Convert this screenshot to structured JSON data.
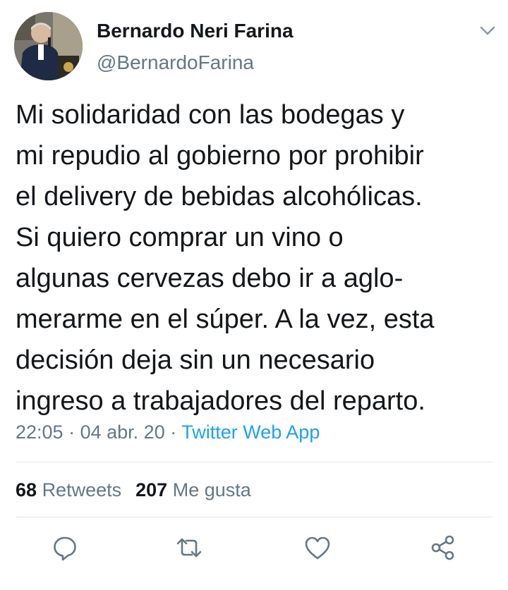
{
  "author": {
    "display_name": "Bernardo Neri Farina",
    "handle": "@BernardoFarina",
    "avatar_icon": "profile-photo"
  },
  "tweet": {
    "lines": [
      "Mi solidaridad con las bodegas y",
      "mi repudio al gobierno por prohibir",
      "el delivery de bebidas alcohólicas.",
      "Si quiero comprar un vino o",
      "algunas cervezas debo ir a aglo-",
      "merarme en el súper. A la vez, esta",
      "decisión deja sin un necesario",
      "ingreso a trabajadores del reparto."
    ]
  },
  "meta": {
    "time": "22:05",
    "separator": "·",
    "date": "04 abr. 20",
    "source": "Twitter Web App"
  },
  "stats": {
    "retweets_count": "68",
    "retweets_label": "Retweets",
    "likes_count": "207",
    "likes_label": "Me gusta"
  },
  "actions": {
    "icons": [
      "reply-icon",
      "retweet-icon",
      "like-icon",
      "share-icon"
    ]
  },
  "colors": {
    "text": "#14171a",
    "secondary": "#657786",
    "link": "#1da1f2",
    "divider": "#e1e8ed"
  }
}
